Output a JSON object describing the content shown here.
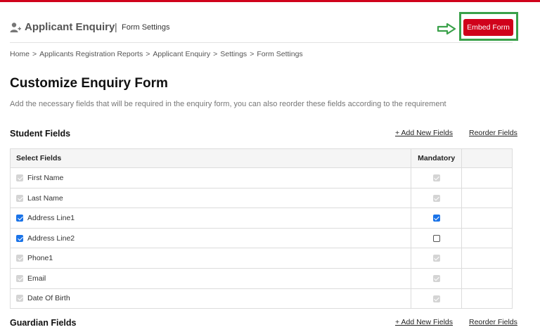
{
  "header": {
    "app_title": "Applicant Enquiry",
    "separator": "|",
    "sub_title": "Form Settings",
    "embed_button": "Embed Form",
    "accent_color": "#d0021b",
    "highlight_color": "#3aa14a"
  },
  "breadcrumb": {
    "items": [
      "Home",
      "Applicants Registration Reports",
      "Applicant Enquiry",
      "Settings",
      "Form Settings"
    ],
    "separator": ">"
  },
  "page": {
    "title": "Customize Enquiry Form",
    "description": "Add the necessary fields that will be required in the enquiry form, you can also reorder these fields according to the requirement"
  },
  "student_section": {
    "title": "Student Fields",
    "add_link": "+ Add New Fields",
    "reorder_link": "Reorder Fields",
    "table": {
      "headers": [
        "Select Fields",
        "Mandatory",
        ""
      ],
      "rows": [
        {
          "label": "First Name",
          "selected": "disabled",
          "mandatory": "disabled"
        },
        {
          "label": "Last Name",
          "selected": "disabled",
          "mandatory": "disabled"
        },
        {
          "label": "Address Line1",
          "selected": "checked",
          "mandatory": "checked"
        },
        {
          "label": "Address Line2",
          "selected": "checked",
          "mandatory": "empty"
        },
        {
          "label": "Phone1",
          "selected": "disabled",
          "mandatory": "disabled"
        },
        {
          "label": "Email",
          "selected": "disabled",
          "mandatory": "disabled"
        },
        {
          "label": "Date Of Birth",
          "selected": "disabled",
          "mandatory": "disabled"
        }
      ]
    }
  },
  "guardian_section": {
    "title": "Guardian Fields",
    "add_link": "+ Add New Fields",
    "reorder_link": "Reorder Fields"
  },
  "icons": {
    "user": "user-add-icon",
    "arrow": "arrow-right-icon"
  }
}
